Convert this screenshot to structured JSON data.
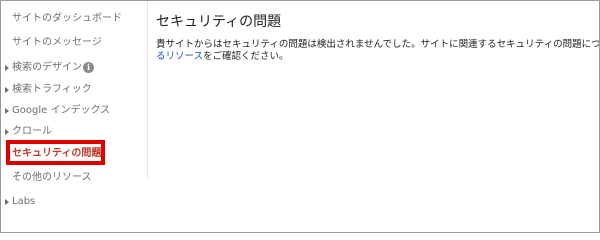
{
  "sidebar": {
    "items": [
      {
        "label": "サイトのダッシュボード"
      },
      {
        "label": "サイトのメッセージ"
      },
      {
        "label": "検索のデザイン",
        "info_icon": "i"
      },
      {
        "label": "検索トラフィック"
      },
      {
        "label": "Google インデックス"
      },
      {
        "label": "クロール"
      },
      {
        "label": "セキュリティの問題"
      },
      {
        "label": "その他のリソース"
      },
      {
        "label": "Labs"
      }
    ],
    "active_item": "セキュリティの問題"
  },
  "main": {
    "title": "セキュリティの問題",
    "message_line1": "貴サイトからはセキュリティの問題は検出されませんでした。サイトに関連するセキュリティの問題について詳しくは",
    "message_link_tail": "るリソース",
    "message_line2_rest": "をご確認ください。"
  },
  "colors": {
    "highlight_border": "#e00000",
    "active_text": "#c0392b",
    "link": "#1a55c4"
  }
}
